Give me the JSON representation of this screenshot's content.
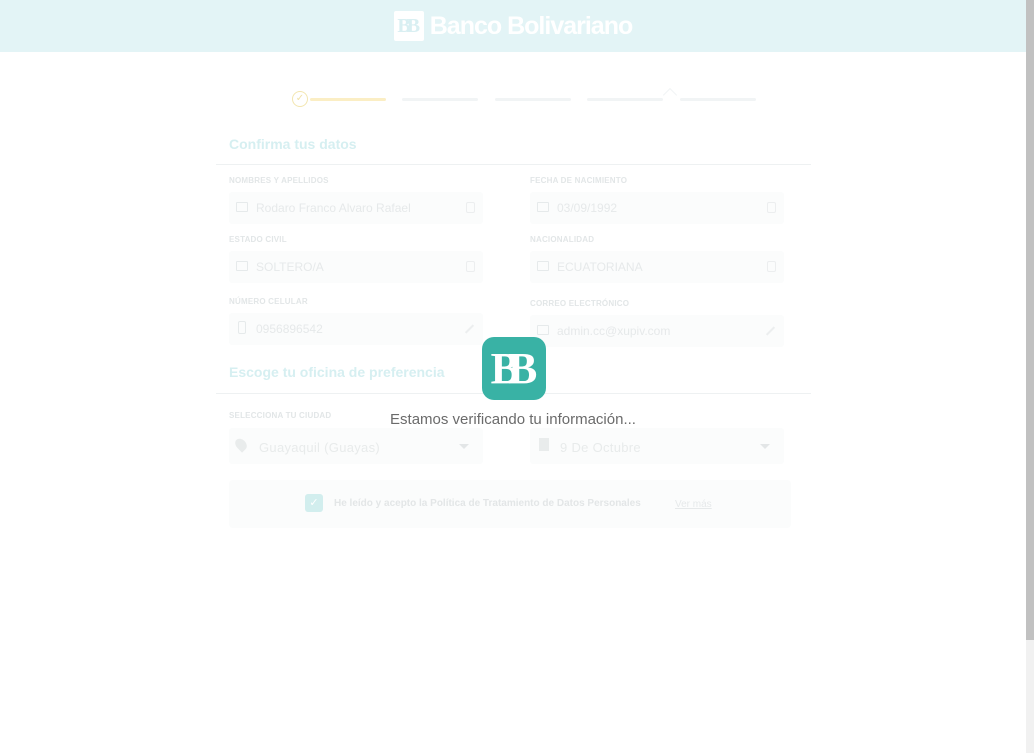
{
  "header": {
    "brand_mark": "BB",
    "brand_name": "Banco Bolivariano"
  },
  "stepper": {
    "check_icon": "✓"
  },
  "section_datos": {
    "title": "Confirma tus datos",
    "fields": [
      {
        "label": "NOMBRES Y APELLIDOS",
        "value": "Rodaro Franco Alvaro Rafael",
        "icon": "id-card-icon",
        "action_icon": "lock-icon"
      },
      {
        "label": "FECHA DE NACIMIENTO",
        "value": "03/09/1992",
        "icon": "id-card-icon",
        "action_icon": "lock-icon"
      },
      {
        "label": "ESTADO CIVIL",
        "value": "SOLTERO/A",
        "icon": "id-card-icon",
        "action_icon": "lock-icon"
      },
      {
        "label": "NACIONALIDAD",
        "value": "ECUATORIANA",
        "icon": "id-card-icon",
        "action_icon": "lock-icon"
      },
      {
        "label": "NÚMERO CELULAR",
        "value": "0956896542",
        "icon": "phone-icon",
        "action_icon": "edit-icon"
      },
      {
        "label": "CORREO ELECTRÓNICO",
        "value": "admin.cc@xupiv.com",
        "icon": "mail-icon",
        "action_icon": "edit-icon"
      }
    ]
  },
  "section_oficina": {
    "title": "Escoge tu oficina de preferencia",
    "city_label": "SELECCIONA TU CIUDAD",
    "city_value": "Guayaquil (Guayas)",
    "office_value": "9 De Octubre"
  },
  "terms": {
    "text": "He leído y acepto la Política de Tratamiento de Datos Personales",
    "link": "Ver más",
    "check_icon": "✓"
  },
  "loader": {
    "logo_mark": "BB",
    "message": "Estamos verificando tu información..."
  },
  "colors": {
    "brand_teal": "#39b2a5",
    "header_bg": "#e3f4f6",
    "progress_done": "#fbeec4"
  }
}
